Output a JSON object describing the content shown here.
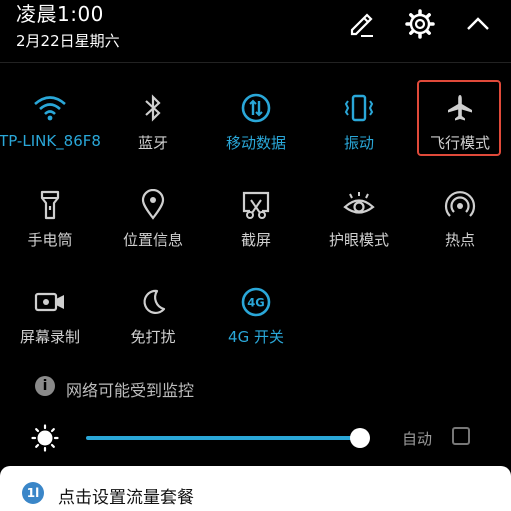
{
  "status": {
    "time": "凌晨1:00",
    "date": "2月22日星期六"
  },
  "header_icons": [
    "edit-icon",
    "settings-gear-icon",
    "collapse-chevron-up-icon"
  ],
  "tiles": [
    {
      "label": "TP-LINK_86F8",
      "icon": "wifi-icon",
      "active": true
    },
    {
      "label": "蓝牙",
      "icon": "bluetooth-icon",
      "active": false
    },
    {
      "label": "移动数据",
      "icon": "mobile-data-icon",
      "active": true
    },
    {
      "label": "振动",
      "icon": "vibrate-icon",
      "active": true
    },
    {
      "label": "飞行模式",
      "icon": "airplane-icon",
      "active": false,
      "highlighted": true
    },
    {
      "label": "手电筒",
      "icon": "flashlight-icon",
      "active": false
    },
    {
      "label": "位置信息",
      "icon": "location-pin-icon",
      "active": false
    },
    {
      "label": "截屏",
      "icon": "screenshot-icon",
      "active": false
    },
    {
      "label": "护眼模式",
      "icon": "eye-icon",
      "active": false
    },
    {
      "label": "热点",
      "icon": "hotspot-icon",
      "active": false
    },
    {
      "label": "屏幕录制",
      "icon": "screen-record-icon",
      "active": false
    },
    {
      "label": "免打扰",
      "icon": "moon-icon",
      "active": false
    },
    {
      "label": "4G 开关",
      "icon": "4g-icon",
      "icon_text": "4G",
      "active": true
    }
  ],
  "notice": {
    "text": "网络可能受到监控",
    "icon_glyph": "i"
  },
  "brightness": {
    "level": 1.0,
    "auto_label": "自动",
    "auto_checked": false
  },
  "bottom_card": {
    "text": "点击设置流量套餐",
    "icon_glyph": "1l"
  },
  "colors": {
    "accent": "#2aa7d8",
    "inactive": "#cfcfcf",
    "highlight": "#e04a3a"
  }
}
